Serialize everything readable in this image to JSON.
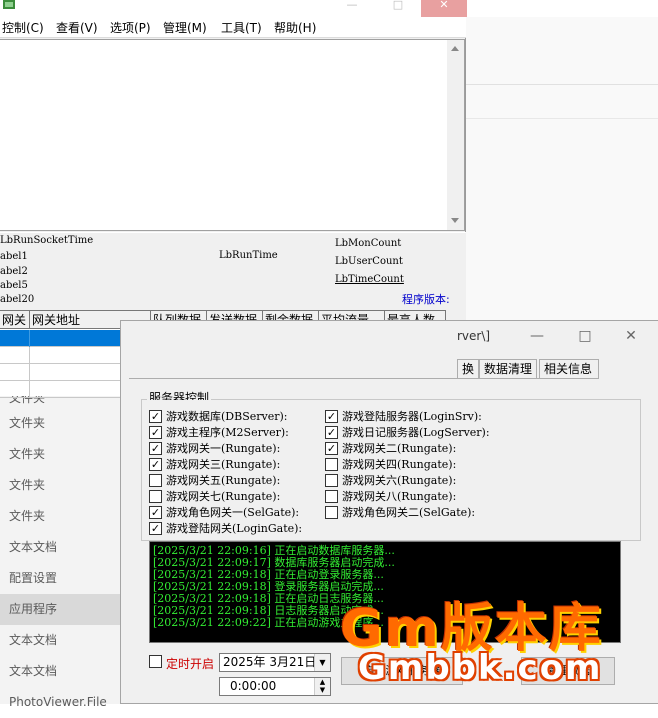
{
  "menu": [
    "控制(C)",
    "查看(V)",
    "选项(P)",
    "管理(M)",
    "工具(T)",
    "帮助(H)"
  ],
  "status_labels": {
    "run_socket_time": "LbRunSocketTime",
    "label1": "abel1",
    "label2": "abel2",
    "label5": "abel5",
    "label20": "abel20",
    "run_time": "LbRunTime",
    "mon_count": "LbMonCount",
    "user_count": "LbUserCount",
    "time_count": "LbTimeCount",
    "version": "程序版本:"
  },
  "gate_table": {
    "columns": [
      "网关",
      "网关地址",
      "队列数据",
      "发送数据",
      "剩余数据",
      "平均流量",
      "最高人数"
    ],
    "rows": [
      [
        "",
        "",
        "",
        "",
        "",
        "",
        ""
      ],
      [
        "",
        "",
        "",
        "",
        "",
        "",
        ""
      ],
      [
        "",
        "",
        "",
        "",
        "",
        "",
        ""
      ],
      [
        "",
        "",
        "",
        "",
        "",
        "",
        ""
      ]
    ],
    "selected_row": 0
  },
  "explorer": {
    "items": [
      "文件夹",
      "文件夹",
      "文件夹",
      "文件夹",
      "文件夹",
      "文本文档",
      "配置设置",
      "应用程序",
      "文本文档",
      "文本文档",
      "PhotoViewer.File"
    ],
    "selected_index": 7
  },
  "launcher": {
    "title_fragment": "rver\\]",
    "tabs": [
      "换",
      "数据清理",
      "相关信息"
    ],
    "group_label": "服务器控制",
    "checkboxes_left": [
      {
        "label": "游戏数据库(DBServer):",
        "checked": true
      },
      {
        "label": "游戏主程序(M2Server):",
        "checked": true
      },
      {
        "label": "游戏网关一(Rungate):",
        "checked": true
      },
      {
        "label": "游戏网关三(Rungate):",
        "checked": true
      },
      {
        "label": "游戏网关五(Rungate):",
        "checked": false
      },
      {
        "label": "游戏网关七(Rungate):",
        "checked": false
      },
      {
        "label": "游戏角色网关一(SelGate):",
        "checked": true
      },
      {
        "label": "游戏登陆网关(LoginGate):",
        "checked": true
      }
    ],
    "checkboxes_right": [
      {
        "label": "游戏登陆服务器(LoginSrv):",
        "checked": true
      },
      {
        "label": "游戏日记服务器(LogServer):",
        "checked": true
      },
      {
        "label": "游戏网关二(Rungate):",
        "checked": true
      },
      {
        "label": "游戏网关四(Rungate):",
        "checked": false
      },
      {
        "label": "游戏网关六(Rungate):",
        "checked": false
      },
      {
        "label": "游戏网关八(Rungate):",
        "checked": false
      },
      {
        "label": "游戏角色网关二(SelGate):",
        "checked": false
      }
    ],
    "log_lines": [
      "[2025/3/21 22:09:16] 正在启动数据库服务器...",
      "[2025/3/21 22:09:17] 数据库服务器启动完成...",
      "[2025/3/21 22:09:18] 正在启动登录服务器...",
      "[2025/3/21 22:09:18] 登录服务器启动完成...",
      "[2025/3/21 22:09:18] 正在启动日志服务器...",
      "[2025/3/21 22:09:18] 日志服务器启动完成...",
      "[2025/3/21 22:09:22] 正在启动游戏主程序..."
    ],
    "timer_label": "定时开启",
    "timer_checked": false,
    "date_value": "2025年 3月21日",
    "time_value": "0:00:00",
    "button_left": "启动游戏服务器",
    "button_right": "清理数据"
  },
  "watermark": {
    "line1": "Gm版本库",
    "line2": "Gmbbk.com"
  },
  "colors": {
    "selection": "#0078d7",
    "log_text": "#33ee33",
    "timer_label": "#cc0000",
    "version_label": "#0000cc",
    "watermark": "#ff6a00"
  }
}
